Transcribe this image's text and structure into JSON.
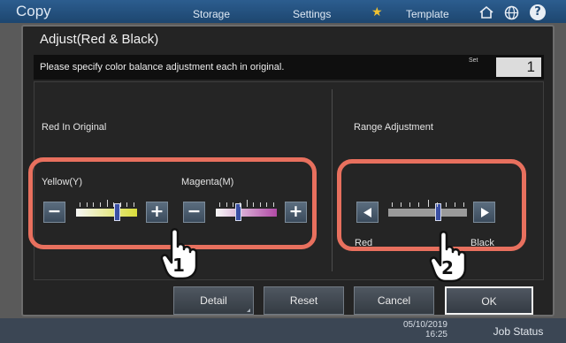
{
  "header": {
    "app_title": "Copy",
    "tabs": [
      "Storage",
      "Settings",
      "Template"
    ],
    "icons": [
      "star-icon",
      "home-icon",
      "globe-icon",
      "help-icon"
    ],
    "help_glyph": "?"
  },
  "dialog": {
    "title": "Adjust(Red & Black)",
    "instruction": "Please specify color balance adjustment each in original.",
    "set_label": "Set",
    "set_value": "1"
  },
  "left_section": {
    "label": "Red In Original",
    "yellow": {
      "label": "Yellow(Y)",
      "minus": "−",
      "plus": "+",
      "level": 0.7
    },
    "magenta": {
      "label": "Magenta(M)",
      "minus": "−",
      "plus": "+",
      "level": 0.35
    }
  },
  "right_section": {
    "label": "Range Adjustment",
    "left_end_label": "Red",
    "right_end_label": "Black",
    "level": 0.65
  },
  "callouts": {
    "first": "1",
    "second": "2"
  },
  "footer": {
    "detail": "Detail",
    "reset": "Reset",
    "cancel": "Cancel",
    "ok": "OK"
  },
  "status": {
    "date": "05/10/2019",
    "time": "16:25",
    "job_status": "Job Status"
  },
  "colors": {
    "callout": "#e8705e",
    "topbar": "#2c5d8f",
    "knob": "#3a4fa4"
  }
}
